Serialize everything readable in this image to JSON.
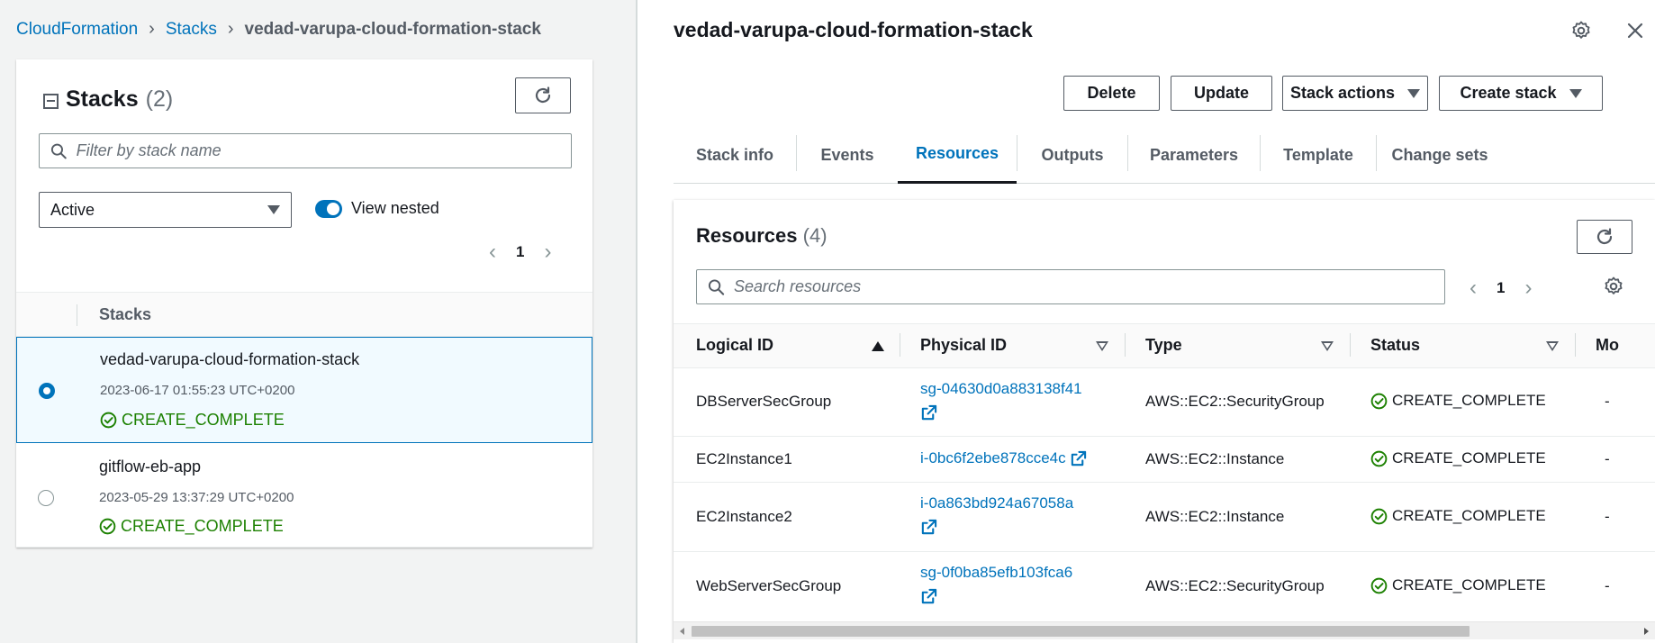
{
  "breadcrumb": {
    "root": "CloudFormation",
    "stacks": "Stacks",
    "current": "vedad-varupa-cloud-formation-stack"
  },
  "stacks_panel": {
    "title": "Stacks",
    "count": "(2)",
    "filter_placeholder": "Filter by stack name",
    "status_filter": "Active",
    "view_nested_label": "View nested",
    "page": "1",
    "column_header": "Stacks",
    "rows": [
      {
        "name": "vedad-varupa-cloud-formation-stack",
        "timestamp": "2023-06-17 01:55:23 UTC+0200",
        "status": "CREATE_COMPLETE",
        "selected": true
      },
      {
        "name": "gitflow-eb-app",
        "timestamp": "2023-05-29 13:37:29 UTC+0200",
        "status": "CREATE_COMPLETE",
        "selected": false
      }
    ]
  },
  "detail": {
    "title": "vedad-varupa-cloud-formation-stack",
    "buttons": {
      "delete": "Delete",
      "update": "Update",
      "stack_actions": "Stack actions",
      "create_stack": "Create stack"
    },
    "tabs": [
      "Stack info",
      "Events",
      "Resources",
      "Outputs",
      "Parameters",
      "Template",
      "Change sets"
    ],
    "active_tab": "Resources"
  },
  "resources": {
    "title": "Resources",
    "count": "(4)",
    "search_placeholder": "Search resources",
    "page": "1",
    "columns": [
      "Logical ID",
      "Physical ID",
      "Type",
      "Status",
      "Mo"
    ],
    "rows": [
      {
        "logical_id": "DBServerSecGroup",
        "physical_id": "sg-04630d0a883138f41",
        "type": "AWS::EC2::SecurityGroup",
        "status": "CREATE_COMPLETE",
        "module": "-"
      },
      {
        "logical_id": "EC2Instance1",
        "physical_id": "i-0bc6f2ebe878cce4c",
        "type": "AWS::EC2::Instance",
        "status": "CREATE_COMPLETE",
        "module": "-"
      },
      {
        "logical_id": "EC2Instance2",
        "physical_id": "i-0a863bd924a67058a",
        "type": "AWS::EC2::Instance",
        "status": "CREATE_COMPLETE",
        "module": "-"
      },
      {
        "logical_id": "WebServerSecGroup",
        "physical_id": "sg-0f0ba85efb103fca6",
        "type": "AWS::EC2::SecurityGroup",
        "status": "CREATE_COMPLETE",
        "module": "-"
      }
    ]
  },
  "colors": {
    "link": "#0073bb",
    "success": "#1d8102",
    "selected_bg": "#f1faff"
  }
}
